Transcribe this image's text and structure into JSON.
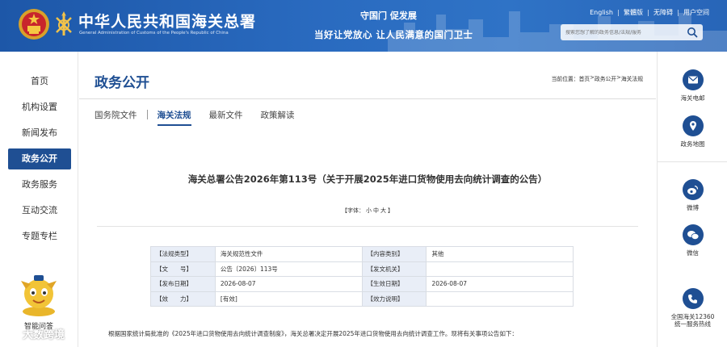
{
  "header": {
    "site_title": "中华人民共和国海关总署",
    "site_subtitle": "General Administration of Customs of the People's Republic of China",
    "slogan1": "守国门  促发展",
    "slogan2": "当好让党放心  让人民满意的国门卫士",
    "links": [
      "English",
      "繁體版",
      "无障碍",
      "用户空间"
    ],
    "search_placeholder": "搜索您想了解的政务信息/法规/服务"
  },
  "leftnav": {
    "items": [
      "首页",
      "机构设置",
      "新闻发布",
      "政务公开",
      "政务服务",
      "互动交流",
      "专题专栏"
    ],
    "active": "政务公开",
    "mascot_label": "智能问答"
  },
  "main": {
    "page_title": "政务公开",
    "breadcrumb": {
      "prefix": "当前位置：",
      "items": [
        "首页",
        "政务公开",
        "海关法规"
      ],
      "separator": " > "
    },
    "tabs": [
      "国务院文件",
      "海关法规",
      "最新文件",
      "政策解读"
    ],
    "active_tab": "海关法规",
    "article_title": "海关总署公告2026年第113号（关于开展2025年进口货物使用去向统计调查的公告）",
    "font_size": {
      "prefix": "【字体：",
      "small": "小",
      "medium": "中",
      "large": "大",
      "suffix": "】"
    },
    "meta": [
      {
        "k1": "【法规类型】",
        "v1": "海关规范性文件",
        "k2": "【内容类别】",
        "v2": "其他"
      },
      {
        "k1": "【文　　号】",
        "v1": "公告〔2026〕113号",
        "k2": "【发文机关】",
        "v2": ""
      },
      {
        "k1": "【发布日期】",
        "v1": "2026-08-07",
        "k2": "【生效日期】",
        "v2": "2026-08-07"
      },
      {
        "k1": "【效　　力】",
        "v1": "[有效]",
        "k2": "【效力说明】",
        "v2": ""
      }
    ],
    "body_text": "根据国家统计局批准的《2025年进口货物使用去向统计调查制度》，海关总署决定开展2025年进口货物使用去向统计调查工作。现将有关事项公告如下："
  },
  "rightbar": {
    "items": [
      "海关电邮",
      "政务地图",
      "微博",
      "微信"
    ],
    "hotline_line1": "全国海关12360",
    "hotline_line2": "统一服务热线"
  },
  "watermark": "大数跨境",
  "colors": {
    "header_blue": "#2a6bc0",
    "nav_active": "#1f4f93",
    "table_key_bg": "#e9eef7"
  }
}
